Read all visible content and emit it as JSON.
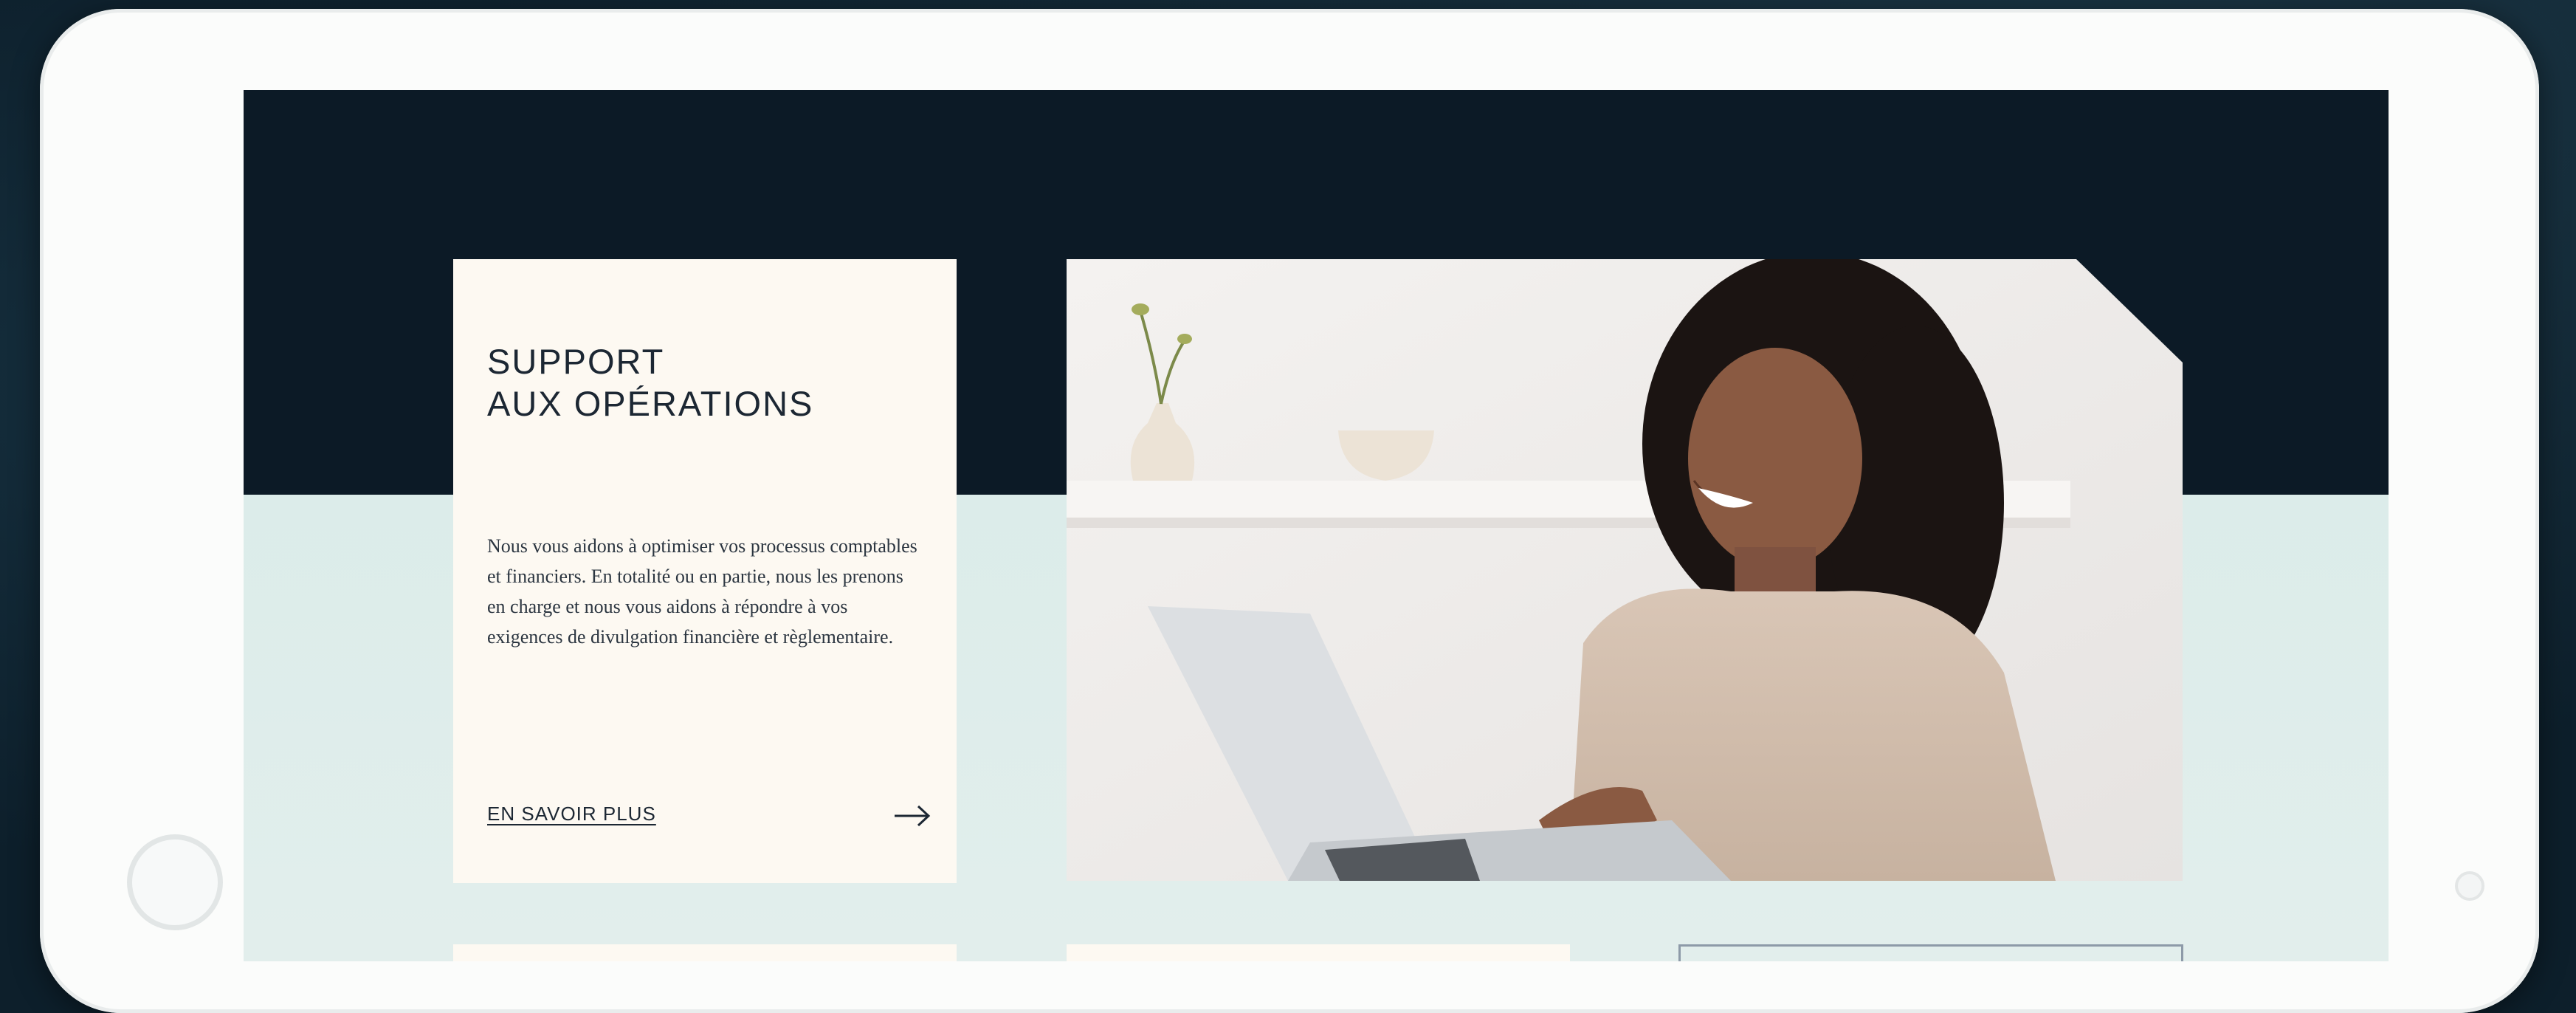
{
  "service_card": {
    "title_line1": "SUPPORT",
    "title_line2": "AUX OPÉRATIONS",
    "body": "Nous vous aidons à optimiser vos processus comptables et financiers. En totalité ou en partie, nous les prenons en charge et nous vous aidons à répondre à vos exigences de divulgation financière et règlementaire.",
    "cta_label": "EN SAVOIR PLUS",
    "cta_icon": "arrow-right-icon"
  },
  "hero_image": {
    "subject": "woman-smiling-at-laptop-photo"
  },
  "colors": {
    "dark_band": "#0c1a26",
    "mint_band": "#d6ebe8",
    "card_background": "#fdf9f2",
    "text_dark": "#1c2733"
  }
}
